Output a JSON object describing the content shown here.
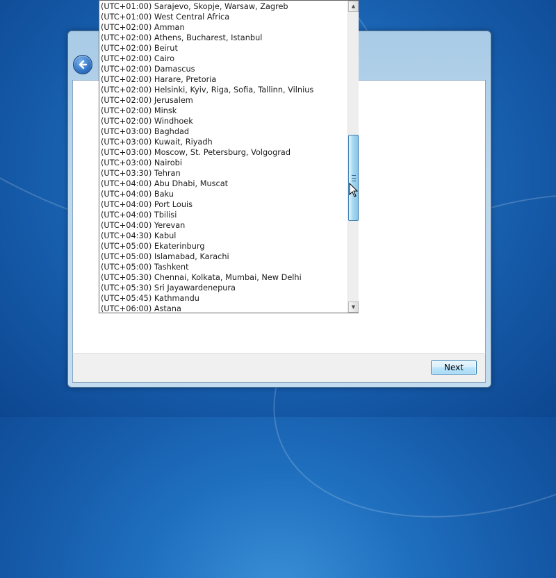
{
  "timezones": [
    "(UTC+01:00) Sarajevo, Skopje, Warsaw, Zagreb",
    "(UTC+01:00) West Central Africa",
    "(UTC+02:00) Amman",
    "(UTC+02:00) Athens, Bucharest, Istanbul",
    "(UTC+02:00) Beirut",
    "(UTC+02:00) Cairo",
    "(UTC+02:00) Damascus",
    "(UTC+02:00) Harare, Pretoria",
    "(UTC+02:00) Helsinki, Kyiv, Riga, Sofia, Tallinn, Vilnius",
    "(UTC+02:00) Jerusalem",
    "(UTC+02:00) Minsk",
    "(UTC+02:00) Windhoek",
    "(UTC+03:00) Baghdad",
    "(UTC+03:00) Kuwait, Riyadh",
    "(UTC+03:00) Moscow, St. Petersburg, Volgograd",
    "(UTC+03:00) Nairobi",
    "(UTC+03:30) Tehran",
    "(UTC+04:00) Abu Dhabi, Muscat",
    "(UTC+04:00) Baku",
    "(UTC+04:00) Port Louis",
    "(UTC+04:00) Tbilisi",
    "(UTC+04:00) Yerevan",
    "(UTC+04:30) Kabul",
    "(UTC+05:00) Ekaterinburg",
    "(UTC+05:00) Islamabad, Karachi",
    "(UTC+05:00) Tashkent",
    "(UTC+05:30) Chennai, Kolkata, Mumbai, New Delhi",
    "(UTC+05:30) Sri Jayawardenepura",
    "(UTC+05:45) Kathmandu",
    "(UTC+06:00) Astana"
  ],
  "footer": {
    "next_label": "Next"
  },
  "icons": {
    "back": "back-arrow-icon",
    "scroll_up": "scroll-up-arrow-icon",
    "scroll_down": "scroll-down-arrow-icon",
    "cursor": "mouse-pointer-icon"
  },
  "colors": {
    "accent": "#3c7fb1",
    "desktop": "#1f6fbf"
  },
  "scroll": {
    "position_fraction": 0.55
  }
}
